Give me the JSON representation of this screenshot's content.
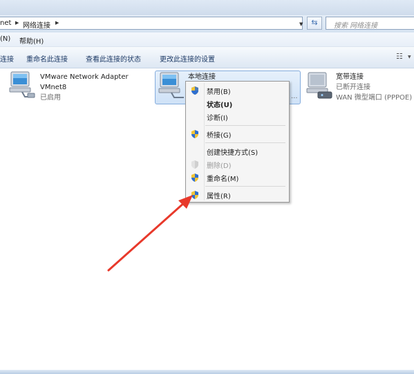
{
  "address": {
    "crumb_partial": "net",
    "crumb_current": "网络连接",
    "search_placeholder": "搜索 网络连接"
  },
  "menubar": {
    "items": [
      {
        "label": "(N)"
      },
      {
        "label": "帮助(H)"
      }
    ]
  },
  "toolbar": {
    "items": [
      {
        "label": "连接"
      },
      {
        "label": "重命名此连接"
      },
      {
        "label": "查看此连接的状态"
      },
      {
        "label": "更改此连接的设置"
      }
    ]
  },
  "connections": [
    {
      "name": "VMware Network Adapter",
      "name2": "VMnet8",
      "status": "已启用"
    },
    {
      "name": "本地连接",
      "status": "",
      "device": "..."
    },
    {
      "name": "宽带连接",
      "status": "已断开连接",
      "device": "WAN 微型端口 (PPPOE)"
    }
  ],
  "context_menu": {
    "items": [
      {
        "label": "禁用(B)",
        "shield": true
      },
      {
        "label": "状态(U)",
        "bold": true
      },
      {
        "label": "诊断(I)"
      },
      {
        "label": "桥接(G)",
        "shield": true
      },
      {
        "label": "创建快捷方式(S)"
      },
      {
        "label": "删除(D)",
        "shield": true,
        "disabled": true
      },
      {
        "label": "重命名(M)",
        "shield": true
      },
      {
        "label": "属性(R)",
        "shield": true
      }
    ]
  },
  "colors": {
    "arrow": "#e8392b",
    "selection": "#cfe2f7",
    "toolbar_text": "#1e3b66"
  }
}
